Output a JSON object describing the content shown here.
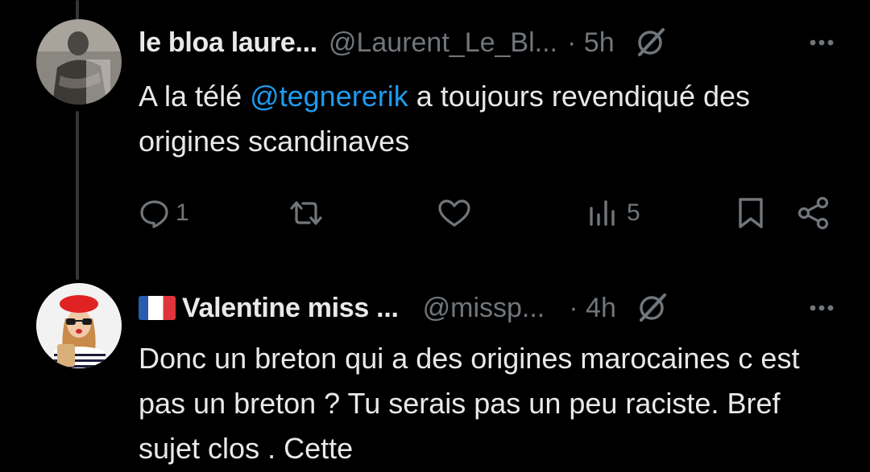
{
  "colors": {
    "background": "#000000",
    "text_primary": "#e7e9ea",
    "text_secondary": "#71767b",
    "mention": "#1d9bf0",
    "thread_line": "#333639"
  },
  "tweets": [
    {
      "display_name": "le bloa laure...",
      "handle": "@Laurent_Le_Bl...",
      "separator": "·",
      "time": "5h",
      "avatar_icon": "vintage-photo-avatar",
      "text_segments": [
        {
          "text": "A la télé ",
          "type": "text"
        },
        {
          "text": "@tegnererik",
          "type": "mention"
        },
        {
          "text": " a toujours revendiqué des origines scandinaves",
          "type": "text"
        }
      ],
      "actions": {
        "reply_count": "1",
        "retweet_count": "",
        "like_count": "",
        "views_count": "5"
      }
    },
    {
      "display_name": "Valentine miss ...",
      "flag_icon": "france-flag-icon",
      "handle": "@missp...",
      "separator": "·",
      "time": "4h",
      "avatar_icon": "woman-red-beret-avatar",
      "text": "Donc un breton qui a des origines marocaines c est pas un breton ? Tu serais pas un peu raciste. Bref sujet clos . Cette"
    }
  ]
}
